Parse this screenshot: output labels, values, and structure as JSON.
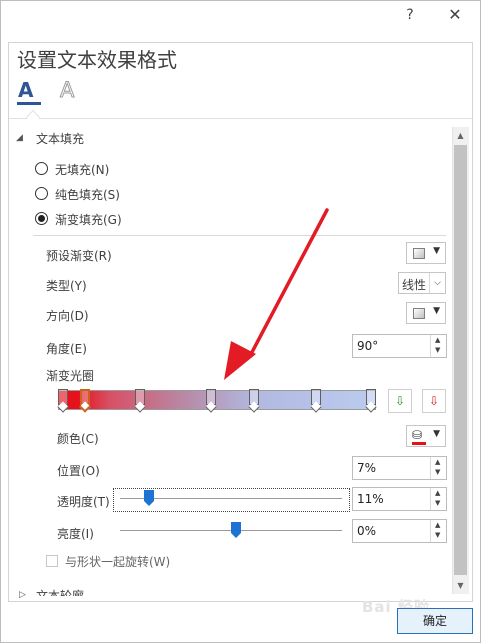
{
  "window": {
    "help": "?",
    "close": "✕"
  },
  "title": "设置文本效果格式",
  "tabs": {
    "fill_tab": "A",
    "effects_tab": "A"
  },
  "section_fill": {
    "caret": "◢",
    "label": "文本填充"
  },
  "fill_options": [
    {
      "label": "无填充(N)",
      "selected": false
    },
    {
      "label": "纯色填充(S)",
      "selected": false
    },
    {
      "label": "渐变填充(G)",
      "selected": true
    }
  ],
  "preset": {
    "label": "预设渐变(R)"
  },
  "type": {
    "label": "类型(Y)",
    "value": "线性"
  },
  "direction": {
    "label": "方向(D)"
  },
  "angle": {
    "label": "角度(E)",
    "value": "90°"
  },
  "gradient": {
    "label": "渐变光圈",
    "stops": [
      {
        "pos": 0.0
      },
      {
        "pos": 0.07,
        "selected": true
      },
      {
        "pos": 0.25
      },
      {
        "pos": 0.48
      },
      {
        "pos": 0.62
      },
      {
        "pos": 0.82
      },
      {
        "pos": 1.0
      }
    ]
  },
  "color": {
    "label": "颜色(C)"
  },
  "position": {
    "label": "位置(O)",
    "value": "7%"
  },
  "transparency": {
    "label": "透明度(T)",
    "value": "11%",
    "level": 0.11
  },
  "brightness": {
    "label": "亮度(I)",
    "value": "0%",
    "level": 0.5
  },
  "rotate_with_shape": {
    "label": "与形状一起旋转(W)"
  },
  "section_outline": {
    "caret": "▷",
    "label": "文本轮廓"
  },
  "ok_button": "确定",
  "watermark": "Bai 经验",
  "colors": {
    "accent": "#2f5597",
    "arrow": "#e21b25",
    "slider_thumb": "#1e73d2"
  }
}
